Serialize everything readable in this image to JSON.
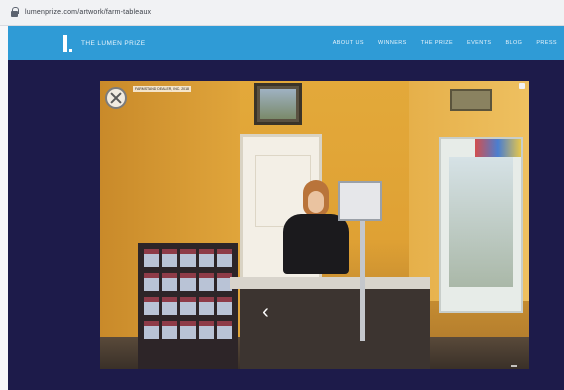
{
  "browser": {
    "url": "lumenprize.com/artwork/farm-tableaux"
  },
  "nav": {
    "brand": "THE LUMEN PRIZE",
    "items": [
      "ABOUT US",
      "WINNERS",
      "THE PRIZE",
      "EVENTS",
      "BLOG",
      "PRESS"
    ]
  },
  "viewer": {
    "label": "FARMSTAND DEALER, INC. 2018",
    "arrow_glyph": "‹"
  },
  "colors": {
    "nav_bg": "#2f9bd6",
    "page_bg": "#1d1b4a"
  }
}
